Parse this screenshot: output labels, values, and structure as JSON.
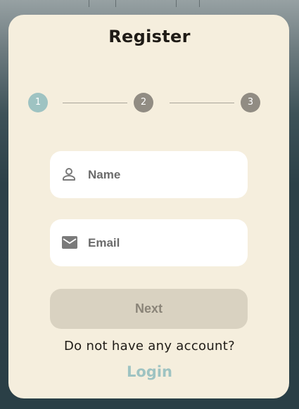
{
  "register": {
    "title": "Register",
    "steps": [
      {
        "label": "1",
        "state": "active"
      },
      {
        "label": "2",
        "state": "inactive"
      },
      {
        "label": "3",
        "state": "inactive"
      }
    ],
    "name_field": {
      "placeholder": "Name",
      "value": "",
      "icon": "person-icon"
    },
    "email_field": {
      "placeholder": "Email",
      "value": "",
      "icon": "mail-icon"
    },
    "next_label": "Next",
    "no_account_text": "Do not have any account?",
    "login_label": "Login"
  },
  "colors": {
    "card_bg": "#f5eedd",
    "step_active": "#9ec3c2",
    "step_inactive": "#918c83",
    "button_disabled_bg": "#d9d2c1",
    "button_disabled_text": "#8a8478",
    "link": "#9ec3c2"
  }
}
